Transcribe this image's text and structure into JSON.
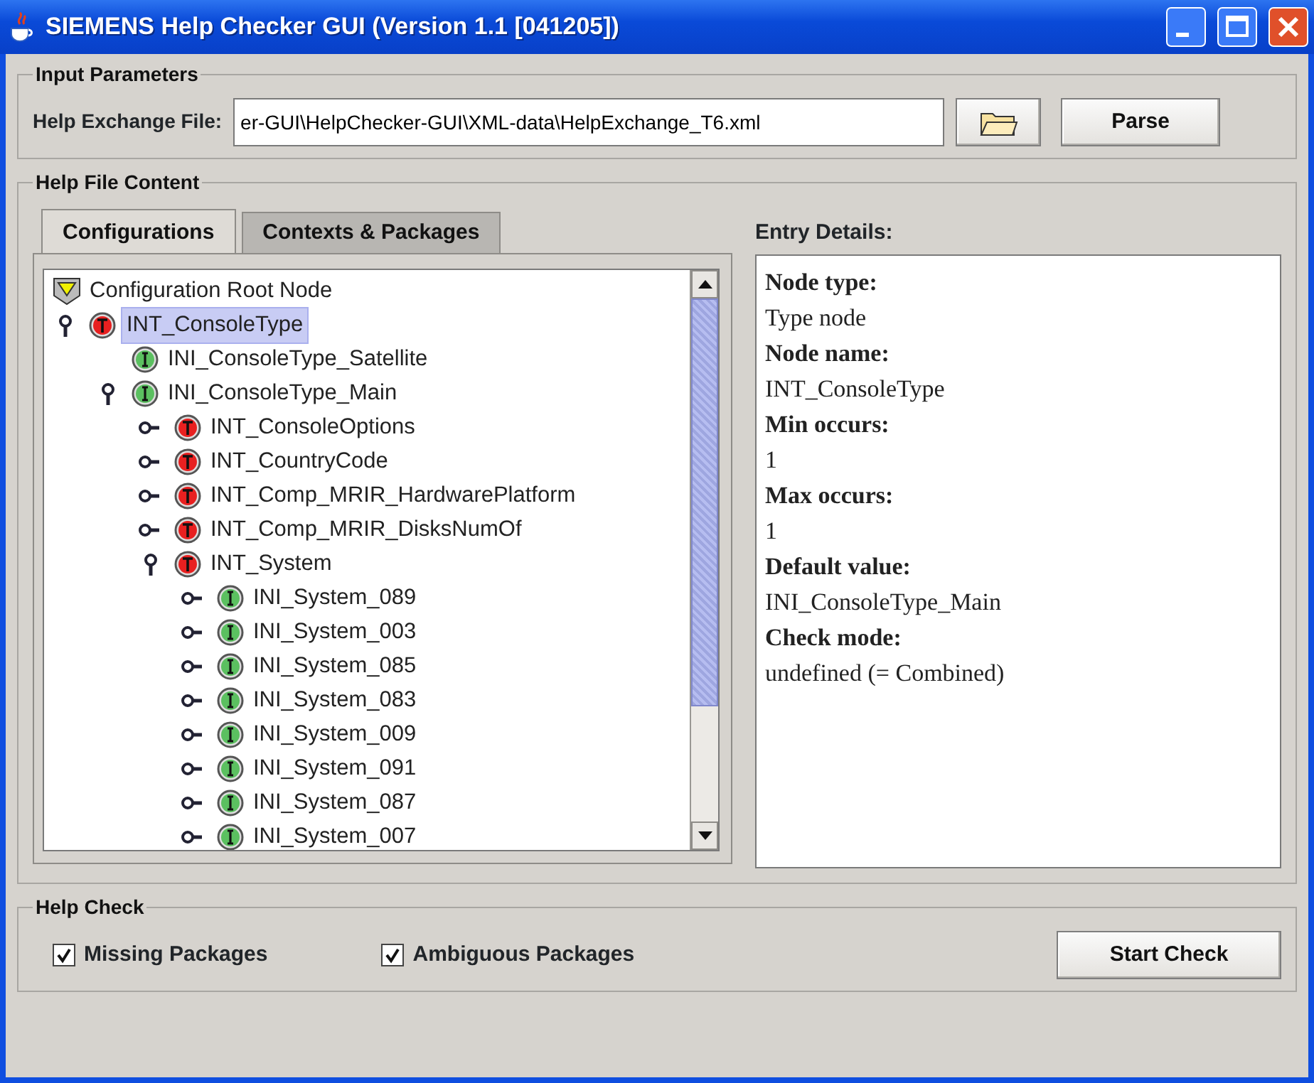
{
  "window": {
    "title": "SIEMENS Help Checker GUI (Version 1.1 [041205])"
  },
  "input_parameters": {
    "title": "Input Parameters",
    "file_label": "Help Exchange File:",
    "file_value": "er-GUI\\HelpChecker-GUI\\XML-data\\HelpExchange_T6.xml",
    "parse_button": "Parse"
  },
  "help_file_content": {
    "title": "Help File Content",
    "tabs": [
      {
        "label": "Configurations",
        "selected": true
      },
      {
        "label": "Contexts & Packages",
        "selected": false
      }
    ],
    "tree": [
      {
        "label": "Configuration Root Node",
        "kind": "root",
        "selected": false,
        "children": [
          {
            "label": "INT_ConsoleType",
            "kind": "type",
            "expanded": true,
            "selected": true,
            "children": [
              {
                "label": "INI_ConsoleType_Satellite",
                "kind": "instance",
                "selected": false
              },
              {
                "label": "INI_ConsoleType_Main",
                "kind": "instance",
                "expanded": true,
                "selected": false,
                "children": [
                  {
                    "label": "INT_ConsoleOptions",
                    "kind": "type",
                    "expanded": false,
                    "selected": false
                  },
                  {
                    "label": "INT_CountryCode",
                    "kind": "type",
                    "expanded": false,
                    "selected": false
                  },
                  {
                    "label": "INT_Comp_MRIR_HardwarePlatform",
                    "kind": "type",
                    "expanded": false,
                    "selected": false
                  },
                  {
                    "label": "INT_Comp_MRIR_DisksNumOf",
                    "kind": "type",
                    "expanded": false,
                    "selected": false
                  },
                  {
                    "label": "INT_System",
                    "kind": "type",
                    "expanded": true,
                    "selected": false,
                    "children": [
                      {
                        "label": "INI_System_089",
                        "kind": "instance",
                        "expanded": false,
                        "selected": false
                      },
                      {
                        "label": "INI_System_003",
                        "kind": "instance",
                        "expanded": false,
                        "selected": false
                      },
                      {
                        "label": "INI_System_085",
                        "kind": "instance",
                        "expanded": false,
                        "selected": false
                      },
                      {
                        "label": "INI_System_083",
                        "kind": "instance",
                        "expanded": false,
                        "selected": false
                      },
                      {
                        "label": "INI_System_009",
                        "kind": "instance",
                        "expanded": false,
                        "selected": false
                      },
                      {
                        "label": "INI_System_091",
                        "kind": "instance",
                        "expanded": false,
                        "selected": false
                      },
                      {
                        "label": "INI_System_087",
                        "kind": "instance",
                        "expanded": false,
                        "selected": false
                      },
                      {
                        "label": "INI_System_007",
                        "kind": "instance",
                        "expanded": false,
                        "selected": false
                      }
                    ]
                  }
                ]
              }
            ]
          }
        ]
      }
    ],
    "details_title": "Entry Details:",
    "details": [
      {
        "label": "Node type:",
        "value": "Type node"
      },
      {
        "label": "Node name:",
        "value": "INT_ConsoleType"
      },
      {
        "label": "Min occurs:",
        "value": "1"
      },
      {
        "label": "Max occurs:",
        "value": "1"
      },
      {
        "label": "Default value:",
        "value": "INI_ConsoleType_Main"
      },
      {
        "label": "Check mode:",
        "value": "undefined (= Combined)"
      }
    ]
  },
  "help_check": {
    "title": "Help Check",
    "options": [
      {
        "label": "Missing Packages",
        "checked": true
      },
      {
        "label": "Ambiguous Packages",
        "checked": true
      }
    ],
    "start_button": "Start Check"
  }
}
